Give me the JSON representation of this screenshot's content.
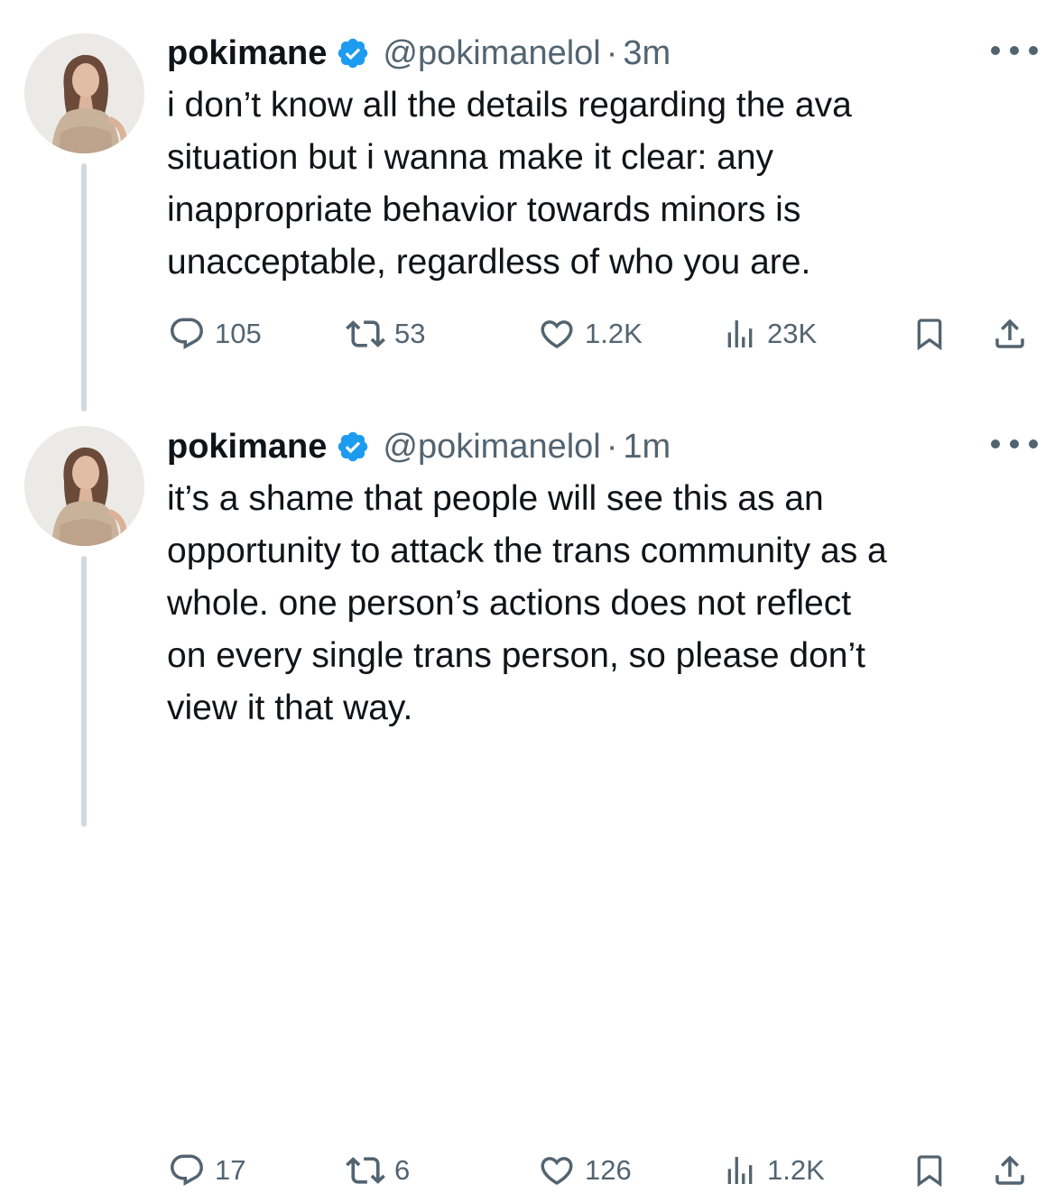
{
  "tweets": [
    {
      "display_name": "pokimane",
      "handle": "@pokimanelol",
      "separator": "·",
      "time": "3m",
      "text": "i don’t know all the details regarding the ava\nsituation but i wanna make it clear: any\ninappropriate behavior towards minors is\nunacceptable, regardless of who you are.",
      "replies": "105",
      "retweets": "53",
      "likes": "1.2K",
      "views": "23K"
    },
    {
      "display_name": "pokimane",
      "handle": "@pokimanelol",
      "separator": "·",
      "time": "1m",
      "text": "it’s a shame that people will see this as an\nopportunity to attack the trans community as a\nwhole. one person’s actions does not reflect\non every single trans person, so please don’t\nview it that way.",
      "replies": "17",
      "retweets": "6",
      "likes": "126",
      "views": "1.2K"
    }
  ],
  "icons": {
    "verified": "verified-badge-icon",
    "more": "more-options-icon",
    "reply": "reply-icon",
    "retweet": "retweet-icon",
    "like": "like-icon",
    "views": "views-icon",
    "bookmark": "bookmark-icon",
    "share": "share-icon"
  },
  "colors": {
    "verified": "#1d9bf0",
    "secondary_text": "#536471",
    "primary_text": "#0f1419",
    "thread_line": "#cfd9de"
  }
}
